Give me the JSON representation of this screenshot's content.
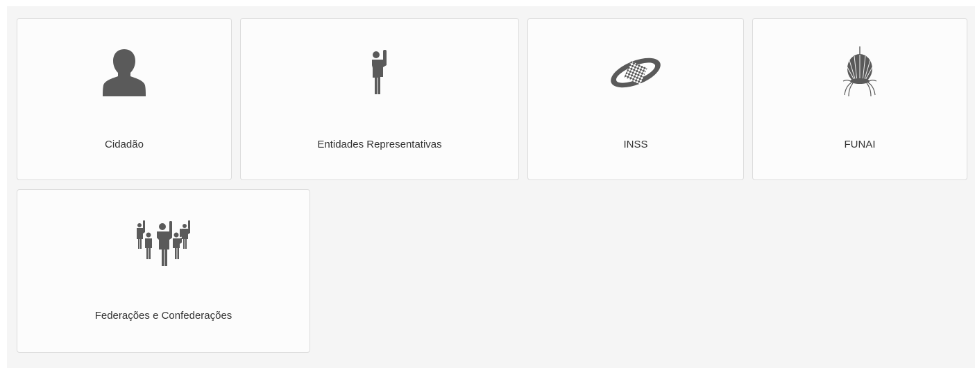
{
  "cards": [
    {
      "label": "Cidadão",
      "icon": "person-silhouette-icon"
    },
    {
      "label": "Entidades Representativas",
      "icon": "raised-hand-person-icon"
    },
    {
      "label": "INSS",
      "icon": "inss-logo-icon"
    },
    {
      "label": "FUNAI",
      "icon": "funai-headdress-icon"
    },
    {
      "label": "Federações e Confederações",
      "icon": "group-raised-hands-icon"
    }
  ],
  "colors": {
    "icon": "#5a5a5a",
    "panel_bg": "#f5f5f5",
    "card_bg": "#fcfcfc",
    "card_border": "#dcdcdc",
    "text": "#333333"
  }
}
